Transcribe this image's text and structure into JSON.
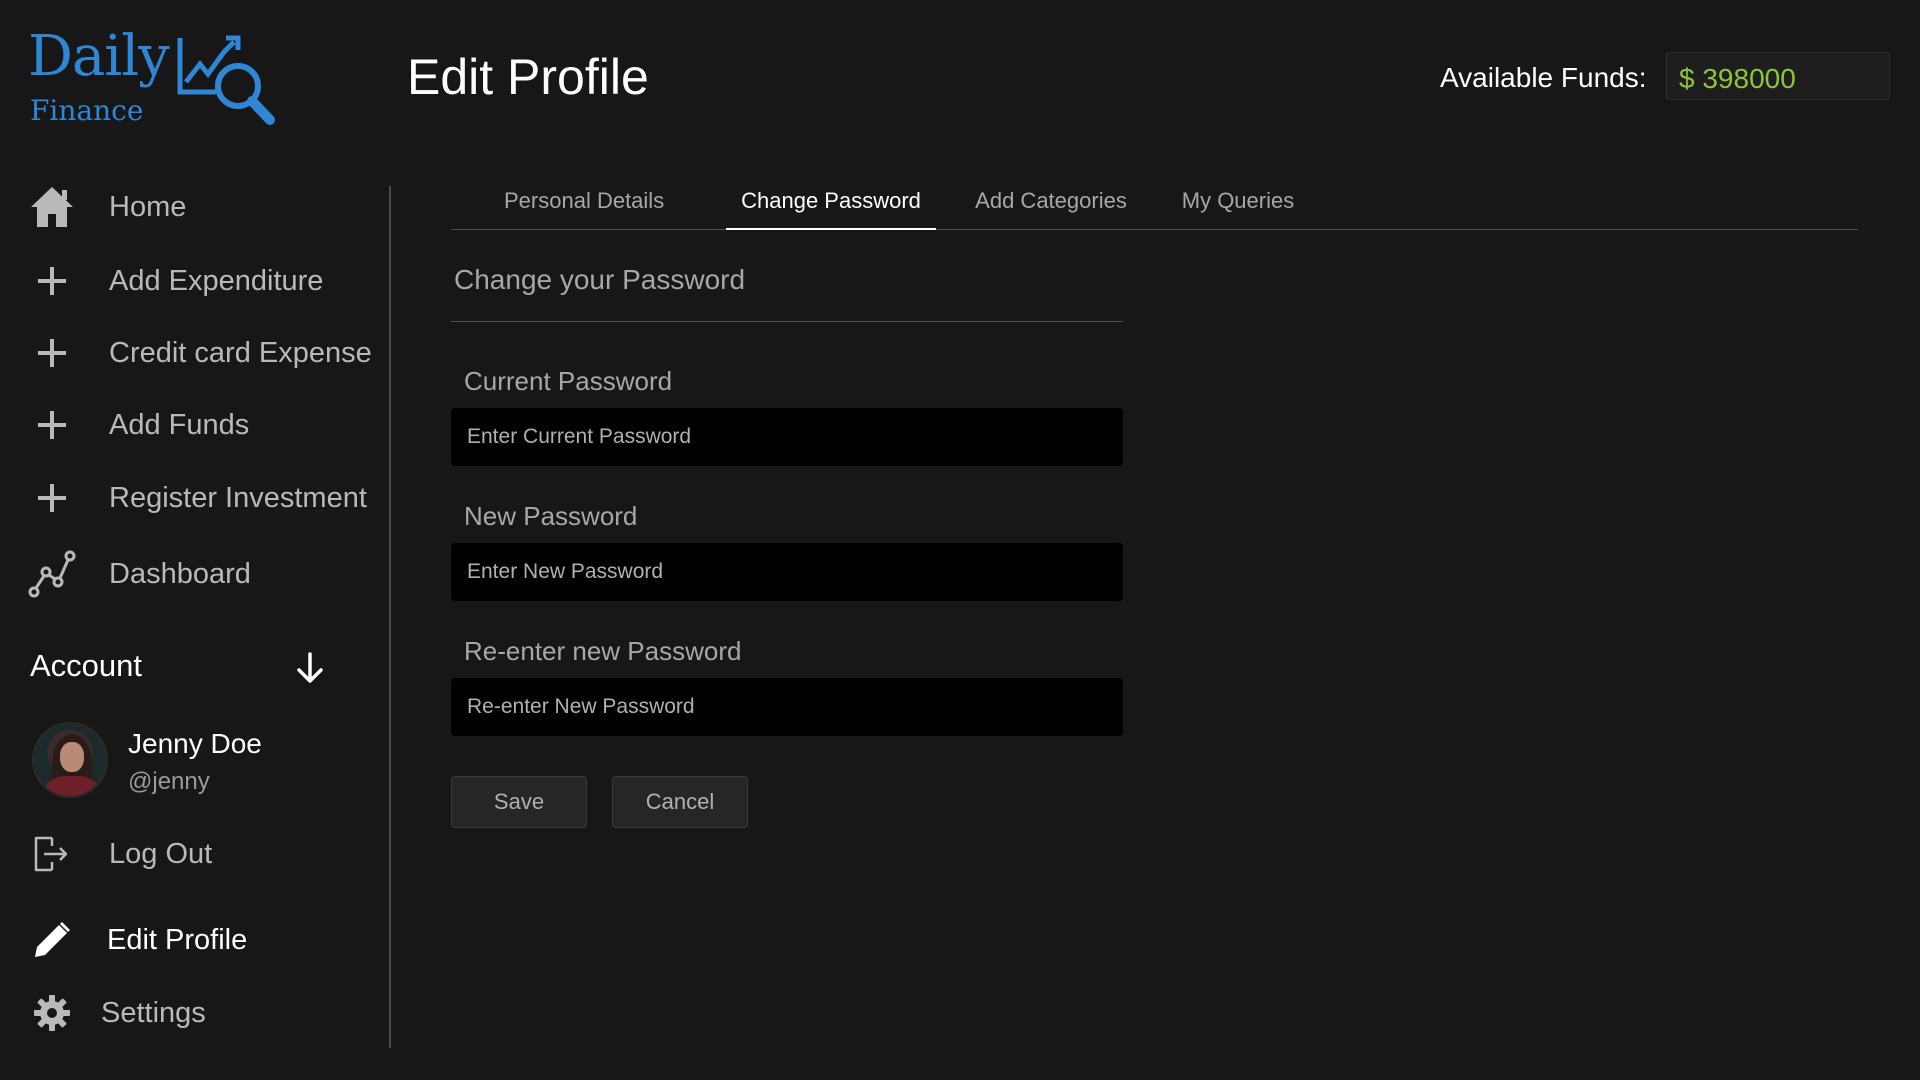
{
  "brand": {
    "name_line1": "Daily",
    "name_line2": "Finance",
    "accent_color": "#2e86d4"
  },
  "header": {
    "title": "Edit Profile",
    "funds_label": "Available Funds:",
    "funds_value": "$ 398000",
    "funds_color": "#8fc43a"
  },
  "sidebar": {
    "items": [
      {
        "label": "Home",
        "icon": "home-icon"
      },
      {
        "label": "Add Expenditure",
        "icon": "plus-icon"
      },
      {
        "label": "Credit card Expense",
        "icon": "plus-icon"
      },
      {
        "label": "Add Funds",
        "icon": "plus-icon"
      },
      {
        "label": "Register Investment",
        "icon": "plus-icon"
      },
      {
        "label": "Dashboard",
        "icon": "line-chart-icon"
      }
    ],
    "account_heading": "Account",
    "user": {
      "name": "Jenny Doe",
      "handle": "@jenny"
    },
    "account_items": [
      {
        "label": "Log Out",
        "icon": "logout-icon"
      },
      {
        "label": "Edit Profile",
        "icon": "pencil-icon",
        "active": true
      },
      {
        "label": "Settings",
        "icon": "gear-icon"
      }
    ]
  },
  "tabs": [
    {
      "label": "Personal Details",
      "active": false
    },
    {
      "label": "Change Password",
      "active": true
    },
    {
      "label": "Add Categories",
      "active": false
    },
    {
      "label": "My Queries",
      "active": false
    }
  ],
  "form": {
    "title": "Change your Password",
    "fields": [
      {
        "label": "Current Password",
        "placeholder": "Enter Current Password",
        "value": ""
      },
      {
        "label": "New Password",
        "placeholder": "Enter New Password",
        "value": ""
      },
      {
        "label": "Re-enter new Password",
        "placeholder": "Re-enter New Password",
        "value": ""
      }
    ],
    "save_label": "Save",
    "cancel_label": "Cancel"
  }
}
